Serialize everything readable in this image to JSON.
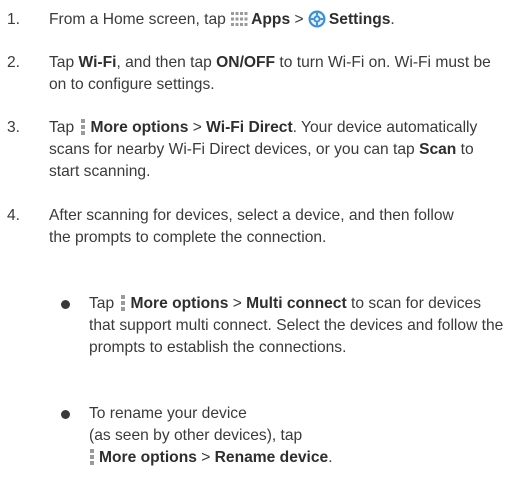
{
  "steps": [
    {
      "num": "1.",
      "s1": "From a Home screen, tap ",
      "apps": "Apps",
      "gt": " > ",
      "settings": "Settings",
      "end": "."
    },
    {
      "num": "2.",
      "s1": "Tap ",
      "wifi": "Wi-Fi",
      "s2": ", and then tap ",
      "onoff": "ON/OFF",
      "s3": " to turn Wi-Fi on. Wi-Fi must be on to configure settings."
    },
    {
      "num": "3.",
      "s1": "Tap ",
      "more": "More options",
      "gt": " > ",
      "wifi_direct": "Wi-Fi Direct",
      "s2": ". Your device automatically scans for nearby Wi-Fi Direct devices, or you can tap ",
      "scan": "Scan",
      "s3": " to start scanning."
    },
    {
      "num": "4.",
      "text": "After scanning for devices, select a device, and then follow the prompts to complete the connection."
    }
  ],
  "bullets": [
    {
      "s1": "Tap ",
      "more": "More options",
      "gt": " > ",
      "multi": "Multi connect",
      "s2": " to scan for devices that support multi connect. Select the devices and follow the prompts to establish the connections."
    },
    {
      "s1": "To rename your device",
      "s2": "(as seen by other devices), tap",
      "more": "More options",
      "gt": " > ",
      "rename": "Rename device",
      "end": "."
    }
  ],
  "icons": {
    "apps": "apps-grid-icon",
    "settings": "settings-gear-icon",
    "more": "more-options-icon"
  },
  "colors": {
    "text": "#3a3a3a",
    "icon_gray": "#9a9a9a",
    "settings_blue": "#3a8fd6"
  }
}
